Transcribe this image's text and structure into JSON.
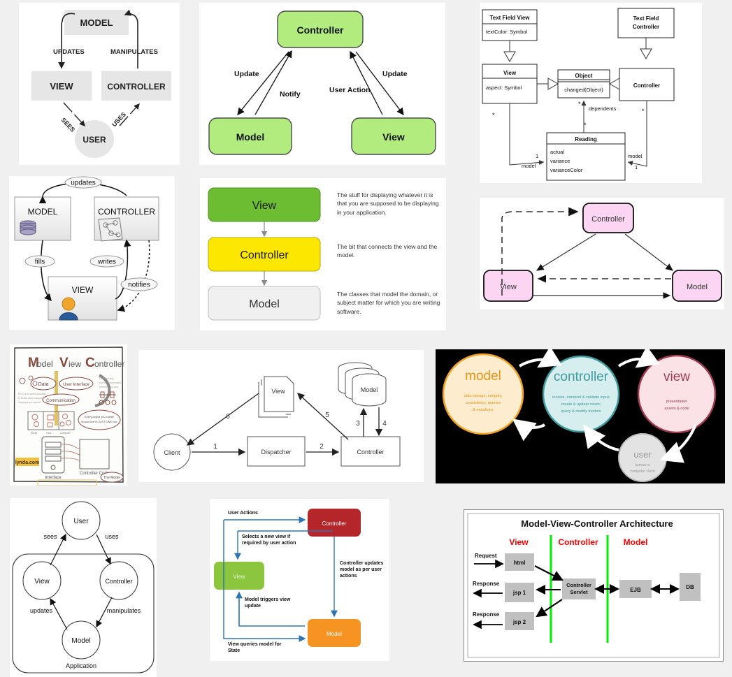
{
  "page": {
    "title": "MVC diagram collage",
    "background": "#f0f0f0"
  },
  "diagrams": [
    {
      "id": "mvc-grey-blocks",
      "title": "MODEL VIEW CONTROLLER USER",
      "nodes": [
        {
          "label": "MODEL"
        },
        {
          "label": "VIEW"
        },
        {
          "label": "CONTROLLER"
        },
        {
          "label": "USER"
        }
      ],
      "edges": [
        {
          "label": "UPDATES"
        },
        {
          "label": "MANIPULATES"
        },
        {
          "label": "SEES"
        },
        {
          "label": "USES"
        }
      ],
      "colors": {
        "box": "#e6e6e6",
        "text": "#222222"
      }
    },
    {
      "id": "mvc-green-triangle",
      "nodes": [
        {
          "label": "Controller"
        },
        {
          "label": "Model"
        },
        {
          "label": "View"
        }
      ],
      "edges": [
        {
          "label": "Update"
        },
        {
          "label": "Notify"
        },
        {
          "label": "User Action"
        },
        {
          "label": "Update"
        }
      ],
      "colors": {
        "box": "#b2ec7e",
        "border": "#4a4a4a",
        "text": "#111111"
      }
    },
    {
      "id": "uml-class-diagram",
      "classes": [
        {
          "name": "Text Field View",
          "attrs": [
            "textColor: Symbol"
          ]
        },
        {
          "name": "Text Field Controller",
          "attrs": []
        },
        {
          "name": "View",
          "attrs": [
            "aspect: Symbol"
          ]
        },
        {
          "name": "Object",
          "attrs": [
            "changed(Object)"
          ]
        },
        {
          "name": "Controller",
          "attrs": []
        },
        {
          "name": "Reading",
          "attrs": [
            "actual",
            "variance",
            "varianceColor"
          ]
        }
      ],
      "edge_labels": [
        "dependents",
        "model",
        "model",
        "1",
        "1",
        "*",
        "*",
        "*",
        "*"
      ]
    },
    {
      "id": "mvc-icons",
      "nodes": [
        {
          "label": "MODEL",
          "icon": "database-icon"
        },
        {
          "label": "CONTROLLER",
          "icon": "network-icon"
        },
        {
          "label": "VIEW",
          "icon": "user-avatar-icon"
        }
      ],
      "edges": [
        {
          "label": "updates"
        },
        {
          "label": "fills"
        },
        {
          "label": "writes"
        },
        {
          "label": "notifies"
        }
      ]
    },
    {
      "id": "mvc-described-stack",
      "rows": [
        {
          "label": "View",
          "color": "#6cbd32",
          "text_color": "#1a1a1a",
          "description": "The stuff for displaying whatever it is that you are supposed to be displaying in your application."
        },
        {
          "label": "Controller",
          "color": "#fbe700",
          "text_color": "#1a1a1a",
          "description": "The bit that connects the view and the model."
        },
        {
          "label": "Model",
          "color": "#f0f0f0",
          "text_color": "#333333",
          "description": "The classes that model the domain, or subject matter for which you are writing software."
        }
      ]
    },
    {
      "id": "mvc-pink",
      "nodes": [
        {
          "label": "Controller"
        },
        {
          "label": "View"
        },
        {
          "label": "Model"
        }
      ],
      "colors": {
        "box": "#fbd5f2",
        "border": "#111111",
        "text": "#333333"
      }
    },
    {
      "id": "lynda-sketchnote",
      "title_parts": [
        "M",
        "odel",
        "V",
        "iew",
        "C",
        "ontroller"
      ],
      "bubbles": [
        "Data",
        "User Interface",
        "Communication"
      ],
      "labels": [
        "Interface",
        "Controller Code",
        "The Model",
        "lynda.com"
      ],
      "colors": {
        "accent": "#8c4a3f",
        "highlight": "#f0c040"
      }
    },
    {
      "id": "dispatcher-flow",
      "nodes": [
        {
          "label": "Client",
          "shape": "circle"
        },
        {
          "label": "Dispatcher",
          "shape": "rect"
        },
        {
          "label": "Controller",
          "shape": "rect"
        },
        {
          "label": "View",
          "shape": "document"
        },
        {
          "label": "Model",
          "shape": "cylinder-stack"
        }
      ],
      "step_labels": [
        "1",
        "2",
        "3",
        "4",
        "5",
        "6"
      ]
    },
    {
      "id": "mvc-circles-dark",
      "background": "#000000",
      "circles": [
        {
          "label": "model",
          "detail": "data storage, integrity, consistency, queries & mutations",
          "fill": "#fdeccd",
          "stroke": "#f0a122",
          "text_color": "#e8941a"
        },
        {
          "label": "controller",
          "detail": "receive, interpret & validate input; create & update views; query & modify models",
          "fill": "#d6eeee",
          "stroke": "#3f9b9e",
          "text_color": "#3f9b9e"
        },
        {
          "label": "view",
          "detail": "presentation assets & code",
          "fill": "#fbe2e6",
          "stroke": "#9e3b4e",
          "text_color": "#9e3b4e"
        },
        {
          "label": "user",
          "detail": "human or computer client",
          "fill": "#e3e3e3",
          "stroke": "#bdbdbd",
          "text_color": "#9a9a9a"
        }
      ]
    },
    {
      "id": "mvc-circle-application",
      "nodes": [
        {
          "label": "User"
        },
        {
          "label": "View"
        },
        {
          "label": "Controller"
        },
        {
          "label": "Model"
        }
      ],
      "edges": [
        {
          "label": "sees"
        },
        {
          "label": "uses"
        },
        {
          "label": "updates"
        },
        {
          "label": "manipulates"
        }
      ],
      "container_label": "Application"
    },
    {
      "id": "mvc-blue-arrows",
      "nodes": [
        {
          "label": "Controller",
          "color": "#b4262a"
        },
        {
          "label": "View",
          "color": "#8cc63e"
        },
        {
          "label": "Model",
          "color": "#f59323"
        }
      ],
      "edges": [
        {
          "label": "User Actions"
        },
        {
          "label": "Selects a new view if required by user action"
        },
        {
          "label": "Controller updates model as per user actions"
        },
        {
          "label": "Model  triggers view update"
        },
        {
          "label": "View queries model for State"
        }
      ],
      "arrow_color": "#2e74b5"
    },
    {
      "id": "mvc-architecture-jsp",
      "title": "Model-View-Controller Architecture",
      "columns": [
        {
          "label": "View",
          "color": "#ff0000"
        },
        {
          "label": "Controller",
          "color": "#ff0000"
        },
        {
          "label": "Model",
          "color": "#ff0000"
        }
      ],
      "boxes": [
        "html",
        "jsp 1",
        "jsp 2",
        "Controller Servlet",
        "EJB",
        "DB"
      ],
      "edge_labels": [
        "Request",
        "Response",
        "Response"
      ],
      "divider_color": "#00ee00",
      "box_color": "#c0c0c0"
    }
  ]
}
